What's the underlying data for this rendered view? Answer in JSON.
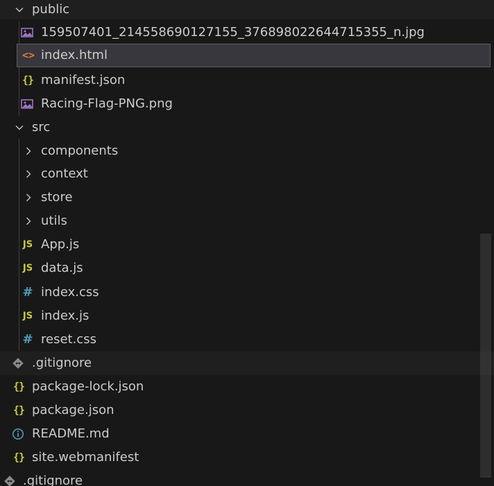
{
  "explorer": {
    "folders": {
      "public": "public",
      "src": "src",
      "components": "components",
      "context": "context",
      "store": "store",
      "utils": "utils"
    },
    "public_files": {
      "jpg": "159507401_214558690127155_376898022644715355_n.jpg",
      "index_html": "index.html",
      "manifest": "manifest.json",
      "racing_flag": "Racing-Flag-PNG.png"
    },
    "src_files": {
      "app": "App.js",
      "data": "data.js",
      "index_css": "index.css",
      "index_js": "index.js",
      "reset": "reset.css"
    },
    "root_files": {
      "gitignore": ".gitignore",
      "package_lock": "package-lock.json",
      "package_json": "package.json",
      "readme": "README.md",
      "webmanifest": "site.webmanifest"
    },
    "bottom_files": {
      "gitignore": ".gitignore"
    }
  },
  "icons": {
    "js": "JS",
    "css": "#",
    "json": "{}",
    "html": "<>",
    "readme": "info-icon",
    "git": "git-icon",
    "image": "image-icon",
    "chevron": "chevron-icon"
  },
  "colors": {
    "background": "#181818",
    "selected": "#37373d",
    "js": "#cbcb41",
    "css": "#519aba",
    "html": "#e37933",
    "image": "#a074c4",
    "info": "#519aba",
    "git": "#8a8a8a"
  }
}
